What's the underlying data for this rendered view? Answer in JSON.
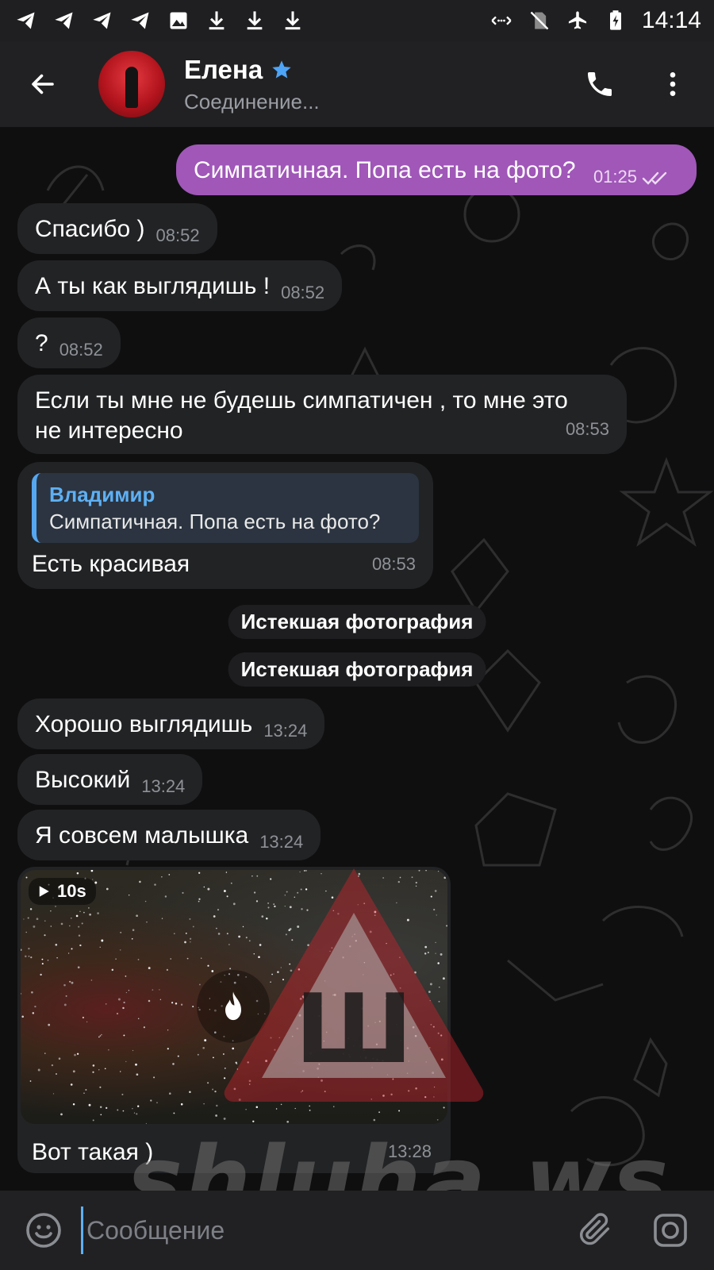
{
  "status_bar": {
    "time": "14:14",
    "left_icons": [
      "telegram-icon",
      "telegram-icon",
      "telegram-icon",
      "telegram-icon",
      "image-icon",
      "download-icon",
      "download-icon",
      "download-icon"
    ],
    "right_icons": [
      "data-transfer-icon",
      "no-sim-icon",
      "airplane-icon",
      "battery-charging-icon"
    ]
  },
  "header": {
    "title": "Елена",
    "status": "Соединение...",
    "verified_star_color": "#4ea4f6"
  },
  "messages": [
    {
      "id": "m1",
      "direction": "out",
      "text": "Симпатичная. Попа есть на фото?",
      "time": "01:25",
      "read": true
    },
    {
      "id": "m2",
      "direction": "in",
      "text": "Спасибо )",
      "time": "08:52"
    },
    {
      "id": "m3",
      "direction": "in",
      "text": "А ты как выглядишь !",
      "time": "08:52"
    },
    {
      "id": "m4",
      "direction": "in",
      "text": "?",
      "time": "08:52"
    },
    {
      "id": "m5",
      "direction": "in",
      "text_line1": "Если ты мне не будешь симпатичен , то мне это",
      "text_line2": "не интересно",
      "time": "08:53"
    },
    {
      "id": "m6",
      "direction": "in",
      "reply_name": "Владимир",
      "reply_text": "Симпатичная. Попа есть на фото?",
      "text": "Есть красивая",
      "time": "08:53"
    },
    {
      "id": "m9",
      "direction": "in",
      "text": "Хорошо выглядишь",
      "time": "13:24"
    },
    {
      "id": "m10",
      "direction": "in",
      "text": "Высокий",
      "time": "13:24"
    },
    {
      "id": "m11",
      "direction": "in",
      "text": "Я совсем малышка",
      "time": "13:24"
    },
    {
      "id": "m12",
      "direction": "in",
      "media": "video",
      "duration": "10s",
      "caption": "Вот такая )",
      "time": "13:28"
    }
  ],
  "service_messages": [
    "Истекшая фотография",
    "Истекшая фотография"
  ],
  "watermark": {
    "text": "shluha.ws",
    "letter": "Ш"
  },
  "input": {
    "placeholder": "Сообщение"
  },
  "colors": {
    "outgoing_bubble": "#a057b8",
    "incoming_bubble": "#222325",
    "accent": "#5eb0f3",
    "background": "#0f0f10"
  }
}
